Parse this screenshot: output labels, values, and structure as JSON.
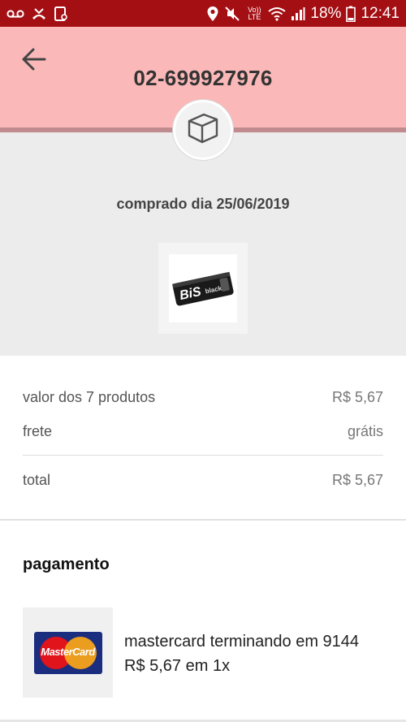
{
  "status_bar": {
    "battery": "18%",
    "time": "12:41",
    "volte_label": "Vo)) LTE"
  },
  "header": {
    "order_id": "02-699927976"
  },
  "order": {
    "purchase_date": "comprado dia 25/06/2019",
    "product_image_alt": "BIS black"
  },
  "summary": {
    "products_label": "valor dos 7 produtos",
    "products_value": "R$ 5,67",
    "shipping_label": "frete",
    "shipping_value": "grátis",
    "total_label": "total",
    "total_value": "R$ 5,67"
  },
  "payment": {
    "title": "pagamento",
    "card_logo_text": "MasterCard",
    "card_line": "mastercard terminando em 9144",
    "amount_line": "R$ 5,67 em 1x"
  },
  "colors": {
    "status_bar": "#a40f14",
    "header_bg": "#fbb8b8",
    "gray_bg": "#ececec"
  }
}
